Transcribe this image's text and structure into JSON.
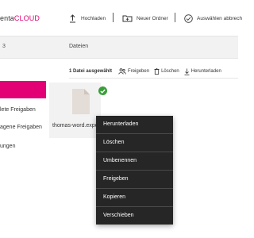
{
  "header": {
    "brand_fragment": "enta",
    "brand_suffix": "CLOUD",
    "upload_label": "Hochladen",
    "new_folder_label": "Neuer Ordner",
    "select_all_label": "Auswählen abbrech"
  },
  "toolbar": {
    "left_fragment": "3",
    "title": "Dateien"
  },
  "sidebar": {
    "items": [
      {
        "label": ""
      },
      {
        "label": "lete Freigaben"
      },
      {
        "label": "agene Freigaben"
      },
      {
        "label": "ungen"
      }
    ]
  },
  "actions": {
    "selection_count": "1 Datei ausgewählt",
    "share_label": "Freigeben",
    "delete_label": "Löschen",
    "download_label": "Herunterladen"
  },
  "file": {
    "name": "thomas-word.expe"
  },
  "context_menu": {
    "items": [
      {
        "label": "Herunterladen"
      },
      {
        "label": "Löschen"
      },
      {
        "label": "Umbenennen"
      },
      {
        "label": "Freigeben"
      },
      {
        "label": "Kopieren"
      },
      {
        "label": "Verschieben"
      }
    ]
  },
  "colors": {
    "accent": "#e20074",
    "menu_bg": "#262626",
    "check": "#3a9e3a"
  }
}
